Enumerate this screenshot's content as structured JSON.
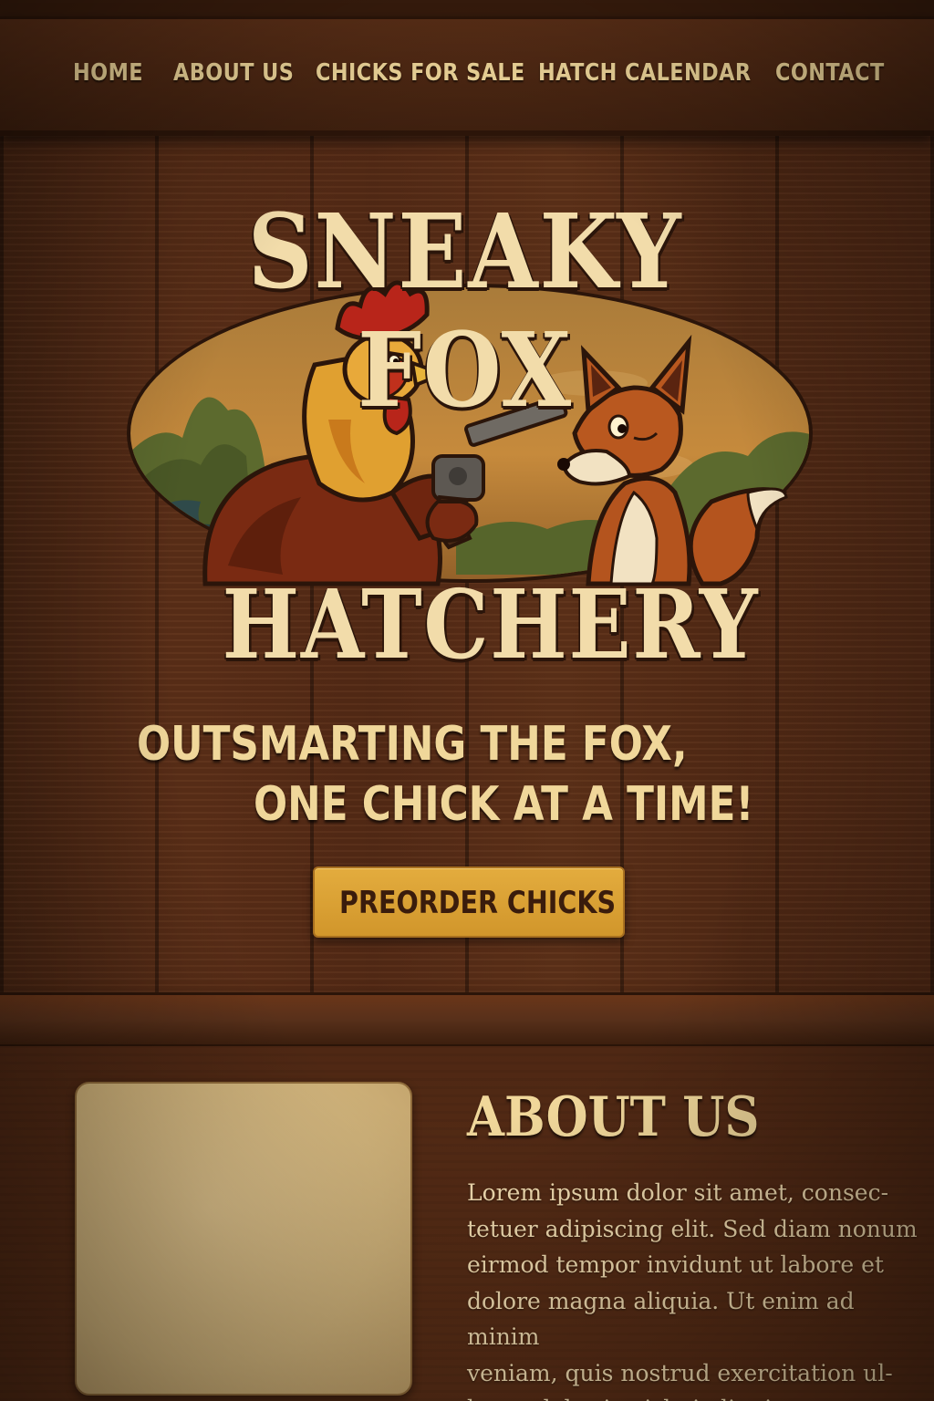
{
  "nav": {
    "items": [
      {
        "label": "HOME"
      },
      {
        "label": "ABOUT US"
      },
      {
        "label": "CHICKS FOR SALE"
      },
      {
        "label": "HATCH CALENDAR"
      },
      {
        "label": "CONTACT"
      }
    ]
  },
  "hero": {
    "brand_top": "SNEAKY FOX",
    "brand_bottom": "HATCHERY",
    "tagline_line1": "OUTSMARTING THE FOX,",
    "tagline_line2": "ONE CHICK AT A TIME!",
    "cta_label": "PREORDER CHICKS"
  },
  "about": {
    "title": "ABOUT US",
    "body": "Lorem ipsum dolor sit amet, consec-\ntetuer adipiscing elit. Sed diam nonum\neirmod tempor invidunt ut labore et\ndolore magna aliquia. Ut enim ad minim\nveniam, quis nostrud exercitation ul-\nlamco laboris nisl ui aliquip ex ea"
  },
  "colors": {
    "wood_dark": "#4a2714",
    "cream_text": "#f0d79a",
    "cta_gold": "#d9a036",
    "parchment": "#d4b781"
  },
  "icons": {
    "emblem": "rooster-with-revolver-and-fox-icon"
  }
}
